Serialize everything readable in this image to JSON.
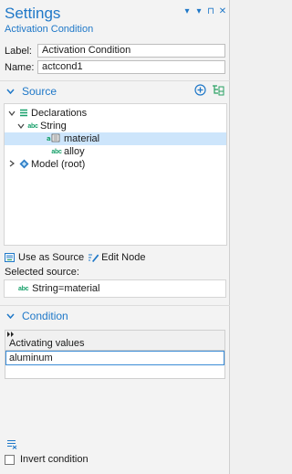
{
  "header": {
    "title": "Settings",
    "subtitle": "Activation Condition",
    "controls": [
      "▾",
      "▾",
      "⊓",
      "✕"
    ]
  },
  "fields": {
    "label_label": "Label:",
    "label_value": "Activation Condition",
    "name_label": "Name:",
    "name_value": "actcond1"
  },
  "source_section": {
    "title": "Source",
    "tree": [
      {
        "label": "Declarations",
        "icon": "declarations-icon",
        "depth": 0,
        "expanded": true
      },
      {
        "label": "String",
        "icon": "abc-icon",
        "depth": 1,
        "expanded": true
      },
      {
        "label": "material",
        "icon": "abc-selected-icon",
        "depth": 2,
        "selected": true
      },
      {
        "label": "alloy",
        "icon": "abc-icon",
        "depth": 2
      },
      {
        "label": "Model (root)",
        "icon": "model-icon",
        "depth": 0,
        "expanded": false
      }
    ],
    "use_as_source": "Use as Source",
    "edit_node": "Edit Node",
    "selected_source_label": "Selected source:",
    "selected_source_value": "String=material",
    "abc_glyph": "abc"
  },
  "condition_section": {
    "title": "Condition",
    "column_header": "Activating values",
    "values": [
      "aluminum"
    ],
    "invert_label": "Invert condition",
    "invert_checked": false
  },
  "colors": {
    "accent": "#1f78c8",
    "selection": "#cde5fb",
    "green": "#17a06a"
  }
}
